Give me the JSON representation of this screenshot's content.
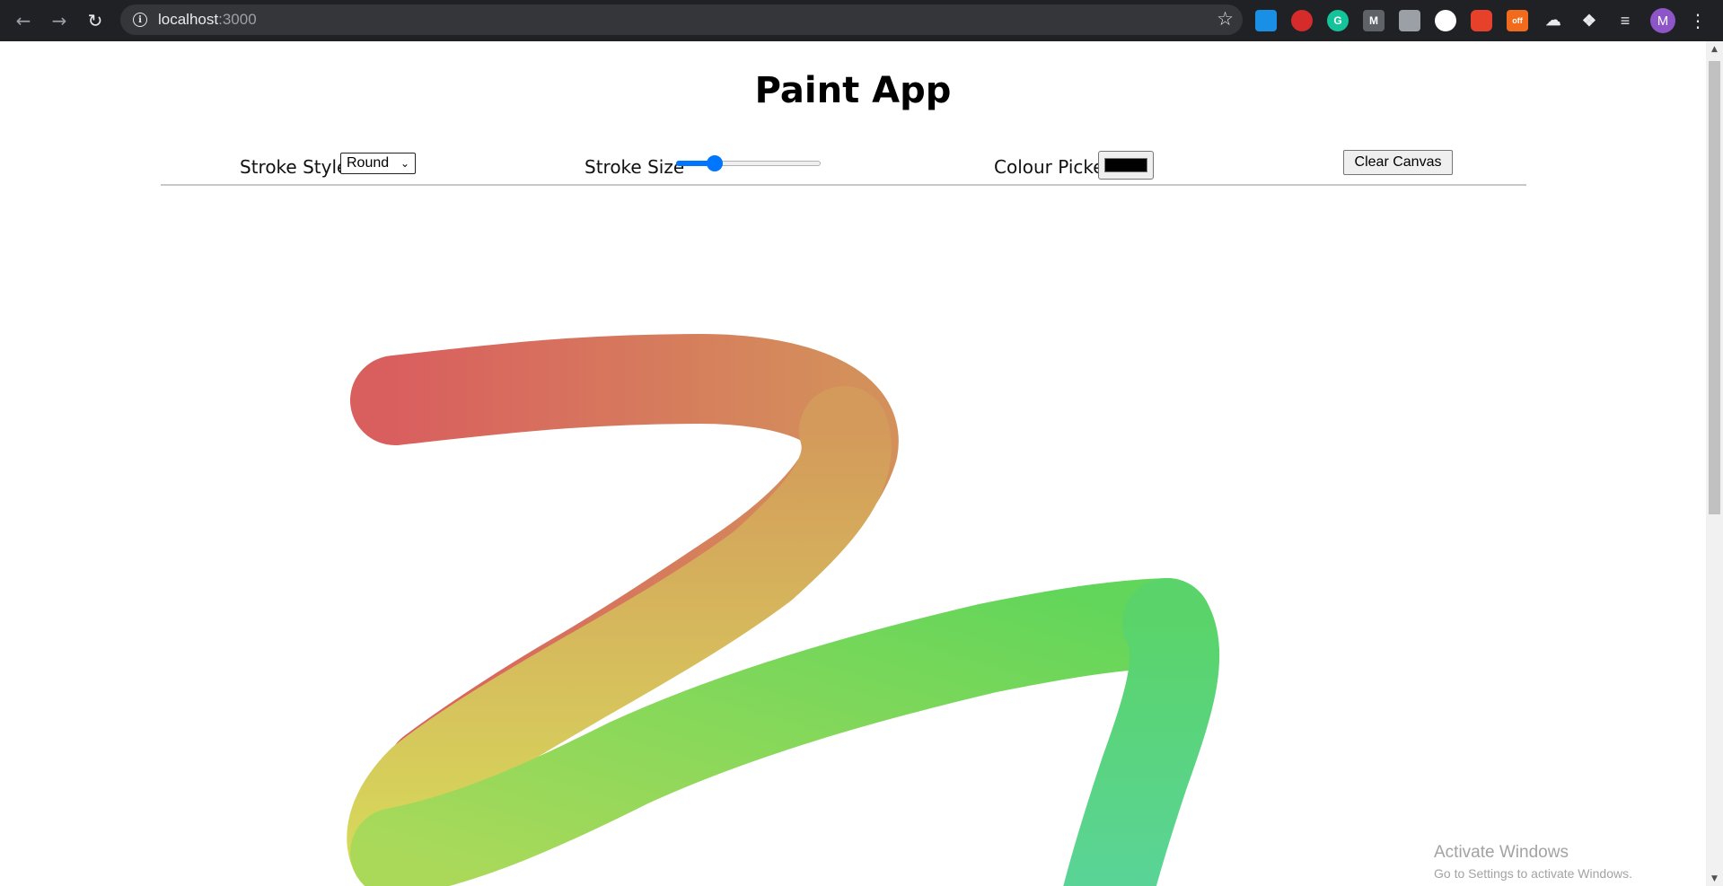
{
  "browser": {
    "url_host": "localhost",
    "url_port": ":3000",
    "avatar_letter": "M",
    "extension_labels": [
      "off"
    ]
  },
  "app": {
    "title": "Paint App"
  },
  "toolbar": {
    "stroke_style_label": "Stroke Style",
    "stroke_style_value": "Round",
    "stroke_size_label": "Stroke Size",
    "stroke_size_level": 0.24,
    "colour_picker_label": "Colour Picker",
    "colour_value": "#000000",
    "clear_button_label": "Clear Canvas"
  },
  "canvas": {
    "stroke_colors": [
      "#d95f5f",
      "#d4a458",
      "#d6d95a",
      "#7bd95a",
      "#5ad47d"
    ]
  },
  "watermark": {
    "line1": "Activate Windows",
    "line2": "Go to Settings to activate Windows."
  }
}
